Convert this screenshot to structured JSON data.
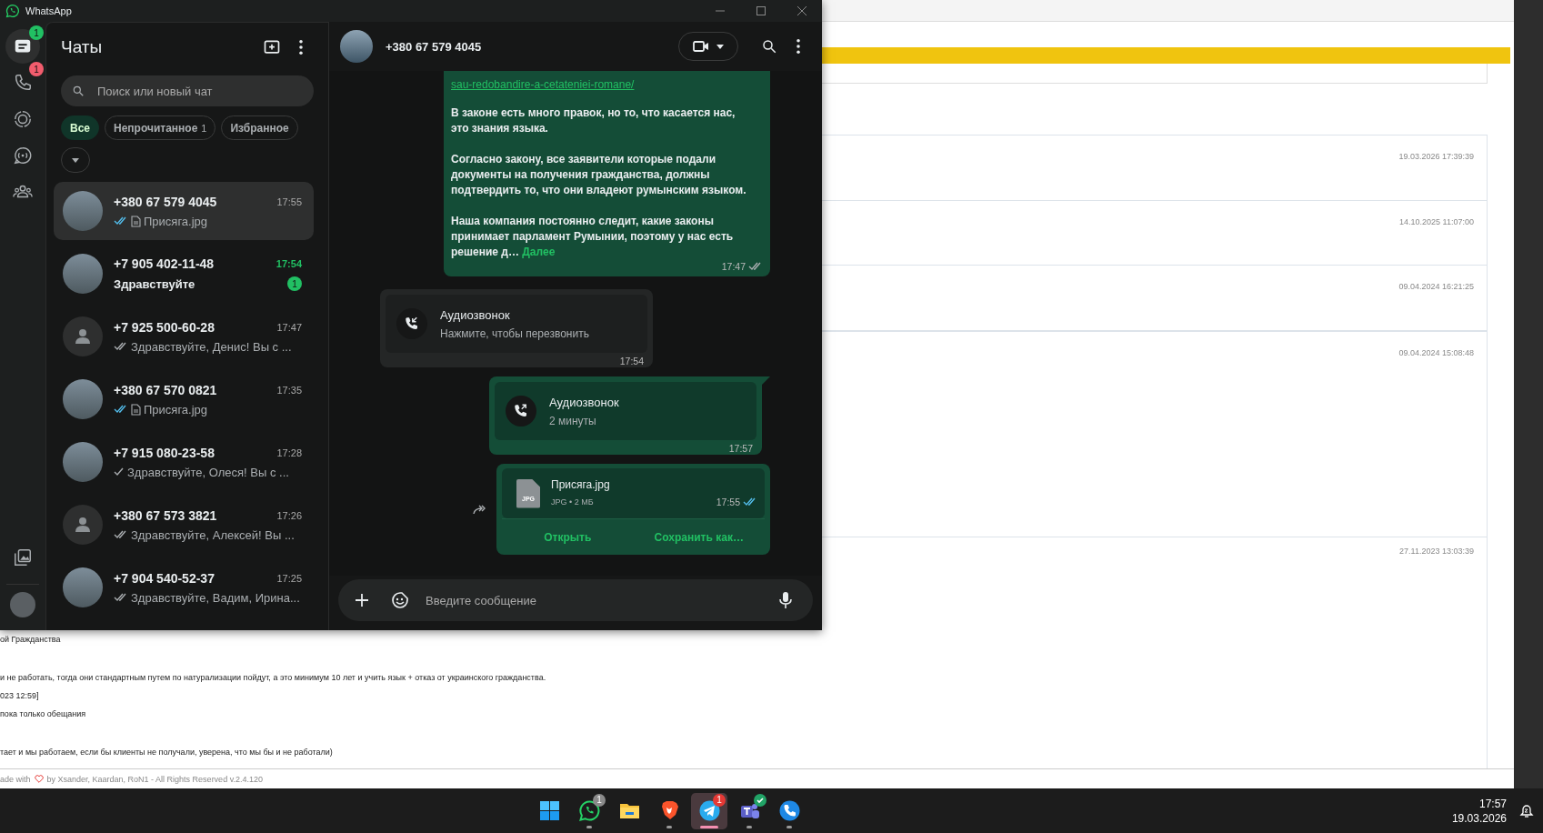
{
  "window": {
    "title": "WhatsApp"
  },
  "rail": {
    "items": [
      {
        "kind": "chats",
        "selected": true,
        "badge": "1",
        "color": "#21c063"
      },
      {
        "kind": "calls",
        "selected": false,
        "badge": "1",
        "color": "#f15c6d"
      },
      {
        "kind": "status",
        "selected": false
      },
      {
        "kind": "channels",
        "selected": false
      },
      {
        "kind": "communities",
        "selected": false
      }
    ],
    "bottom": [
      {
        "kind": "media",
        "selected": false
      },
      {
        "kind": "profile"
      }
    ]
  },
  "chat_list": {
    "title": "Чаты",
    "search": {
      "placeholder": "Поиск или новый чат"
    },
    "filters": [
      {
        "label": "Все",
        "selected": true
      },
      {
        "label": "Непрочитанное",
        "count": "1",
        "selected": false
      },
      {
        "label": "Избранное",
        "selected": false
      }
    ],
    "chats": [
      {
        "name": "+380 67 579 4045",
        "time": "17:55",
        "preview": "Присяга.jpg",
        "tick": true,
        "double": true,
        "read": true,
        "attachment": true,
        "photo": true,
        "selected": true
      },
      {
        "name": "+7 905 402-11-48",
        "time": "17:54",
        "preview": "Здравствуйте",
        "tick": false,
        "attachment": false,
        "photo": true,
        "unread": "1",
        "selected": false
      },
      {
        "name": "+7 925 500-60-28",
        "time": "17:47",
        "preview": "Здравствуйте, Денис!  Вы с ...",
        "tick": true,
        "double": true,
        "read": false,
        "attachment": false,
        "photo": false,
        "selected": false
      },
      {
        "name": "+380 67 570 0821",
        "time": "17:35",
        "preview": "Присяга.jpg",
        "tick": true,
        "double": true,
        "read": true,
        "attachment": true,
        "photo": true,
        "selected": false
      },
      {
        "name": "+7 915 080-23-58",
        "time": "17:28",
        "preview": "Здравствуйте, Олеся!  Вы с ...",
        "tick": true,
        "double": false,
        "read": false,
        "attachment": false,
        "photo": true,
        "selected": false
      },
      {
        "name": "+380 67 573 3821",
        "time": "17:26",
        "preview": "Здравствуйте, Алексей!  Вы ...",
        "tick": true,
        "double": true,
        "read": false,
        "attachment": false,
        "photo": false,
        "selected": false
      },
      {
        "name": "+7 904 540-52-37",
        "time": "17:25",
        "preview": "Здравствуйте, Вадим, Ирина...",
        "tick": true,
        "double": true,
        "read": false,
        "attachment": false,
        "photo": true,
        "selected": false
      }
    ]
  },
  "conversation": {
    "contact": "+380 67 579 4045",
    "messages": [
      {
        "kind": "text",
        "outgoing": true,
        "link": "sau-redobandire-a-cetateniei-romane/",
        "paragraphs": [
          "В законе есть много правок, но то, что касается нас, это знания языка.",
          "Согласно закону, все заявители которые подали документы на получения гражданства, должны подтвердить то, что они владеют румынским языком.",
          "Наша компания постоянно следит, какие законы принимает парламент Румынии, поэтому у нас есть решение д…"
        ],
        "more": "Далее",
        "time": "17:47",
        "tick": true,
        "double": true,
        "read": false
      },
      {
        "kind": "call",
        "outgoing": false,
        "title": "Аудиозвонок",
        "subtitle": "Нажмите, чтобы перезвонить",
        "time": "17:54"
      },
      {
        "kind": "call",
        "outgoing": true,
        "title": "Аудиозвонок",
        "subtitle": "2 минуты",
        "time": "17:57"
      },
      {
        "kind": "file",
        "outgoing": true,
        "forward": true,
        "file_type": "JPG",
        "name": "Присяга.jpg",
        "meta": "JPG • 2 МБ",
        "time": "17:55",
        "tick": true,
        "double": true,
        "read": true,
        "actions": [
          "Открыть",
          "Сохранить как…"
        ]
      }
    ],
    "composer": {
      "placeholder": "Введите сообщение"
    }
  },
  "browser_page": {
    "dates": [
      "19.03.2026 17:39:39",
      "14.10.2025 11:07:00",
      "09.04.2024 16:21:25",
      "09.04.2024 15:08:48",
      "27.11.2023 13:03:39"
    ],
    "lines": [
      "ой Гражданства",
      "и не работать, тогда они стандартным путем по натурализации пойдут, а это минимум 10 лет и учить язык + отказ от украинского гражданства.",
      "023 12:59]",
      "пока только обещания",
      "тает и мы работаем, если бы клиенты не получали, уверена, что мы бы и не работали)"
    ],
    "footer_start": "ade with",
    "footer_end": "by Xsander, Kaardan, RoN1 - All Rights Reserved v.2.4.120"
  },
  "taskbar": {
    "apps": [
      {
        "kind": "start",
        "selected": false,
        "running": false
      },
      {
        "kind": "whatsapp",
        "selected": false,
        "running": true,
        "badge": "1",
        "color": "#8a8a8a"
      },
      {
        "kind": "explorer",
        "selected": false,
        "running": false
      },
      {
        "kind": "brave",
        "selected": false,
        "running": true
      },
      {
        "kind": "telegram",
        "selected": true,
        "running": true,
        "badge": "1",
        "color": "#e53935"
      },
      {
        "kind": "teams",
        "selected": false,
        "running": true,
        "check": true
      },
      {
        "kind": "phone",
        "selected": false,
        "running": true
      }
    ],
    "time": "17:57",
    "date": "19.03.2026"
  }
}
